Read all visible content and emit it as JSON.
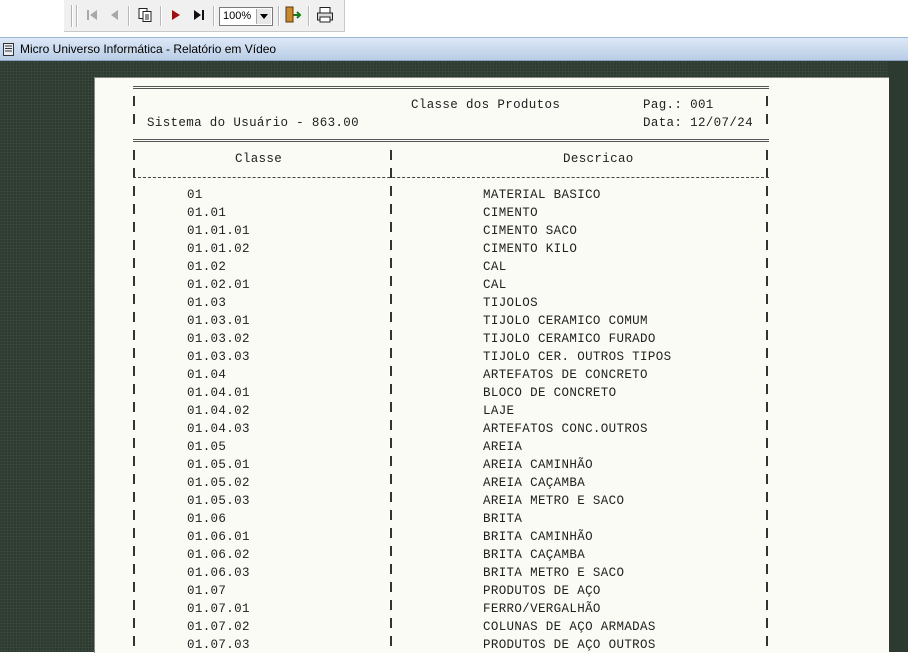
{
  "toolbar": {
    "buttons": [
      {
        "name": "first-page-icon",
        "glyph": "|◀"
      },
      {
        "name": "prev-page-icon",
        "glyph": "◀"
      },
      {
        "name": "copy-pages-icon",
        "glyph": "⧉"
      },
      {
        "name": "next-page-icon",
        "glyph": "▶"
      },
      {
        "name": "last-page-icon",
        "glyph": "▶|"
      },
      {
        "name": "exit-icon",
        "glyph": "⇦"
      },
      {
        "name": "print-icon",
        "glyph": "⎙"
      }
    ],
    "zoom": "100%"
  },
  "window": {
    "title": "Micro Universo Informática - Relatório em Vídeo"
  },
  "report": {
    "title": "Classe dos Produtos",
    "page_label": "Pag.: 001",
    "system_label": "Sistema do Usuário - 863.00",
    "date_label": "Data: 12/07/24",
    "col_classe": "Classe",
    "col_descricao": "Descricao",
    "rows": [
      {
        "classe": "01",
        "descricao": "MATERIAL BASICO"
      },
      {
        "classe": "01.01",
        "descricao": "CIMENTO"
      },
      {
        "classe": "01.01.01",
        "descricao": "CIMENTO SACO"
      },
      {
        "classe": "01.01.02",
        "descricao": "CIMENTO KILO"
      },
      {
        "classe": "01.02",
        "descricao": "CAL"
      },
      {
        "classe": "01.02.01",
        "descricao": "CAL"
      },
      {
        "classe": "01.03",
        "descricao": "TIJOLOS"
      },
      {
        "classe": "01.03.01",
        "descricao": "TIJOLO CERAMICO COMUM"
      },
      {
        "classe": "01.03.02",
        "descricao": "TIJOLO CERAMICO FURADO"
      },
      {
        "classe": "01.03.03",
        "descricao": "TIJOLO CER. OUTROS TIPOS"
      },
      {
        "classe": "01.04",
        "descricao": "ARTEFATOS DE CONCRETO"
      },
      {
        "classe": "01.04.01",
        "descricao": "BLOCO DE CONCRETO"
      },
      {
        "classe": "01.04.02",
        "descricao": "LAJE"
      },
      {
        "classe": "01.04.03",
        "descricao": "ARTEFATOS CONC.OUTROS"
      },
      {
        "classe": "01.05",
        "descricao": "AREIA"
      },
      {
        "classe": "01.05.01",
        "descricao": "AREIA CAMINHÃO"
      },
      {
        "classe": "01.05.02",
        "descricao": "AREIA CAÇAMBA"
      },
      {
        "classe": "01.05.03",
        "descricao": "AREIA METRO E SACO"
      },
      {
        "classe": "01.06",
        "descricao": "BRITA"
      },
      {
        "classe": "01.06.01",
        "descricao": "BRITA CAMINHÃO"
      },
      {
        "classe": "01.06.02",
        "descricao": "BRITA CAÇAMBA"
      },
      {
        "classe": "01.06.03",
        "descricao": "BRITA METRO E SACO"
      },
      {
        "classe": "01.07",
        "descricao": "PRODUTOS DE AÇO"
      },
      {
        "classe": "01.07.01",
        "descricao": "FERRO/VERGALHÃO"
      },
      {
        "classe": "01.07.02",
        "descricao": "COLUNAS DE AÇO ARMADAS"
      },
      {
        "classe": "01.07.03",
        "descricao": "PRODUTOS DE AÇO OUTROS"
      }
    ]
  }
}
